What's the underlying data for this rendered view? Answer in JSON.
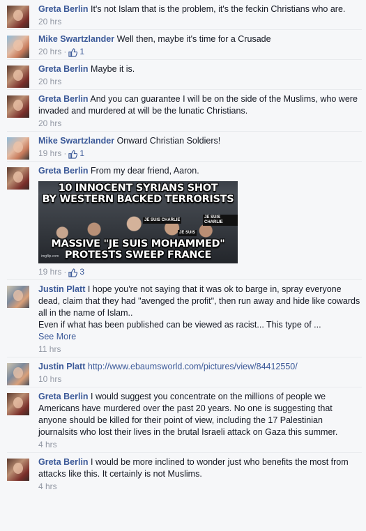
{
  "comments": [
    {
      "author": "Greta Berlin",
      "avatar": "greta",
      "text": "It's not Islam that is the problem, it's the feckin Christians who are.",
      "time": "20 hrs",
      "likes": ""
    },
    {
      "author": "Mike Swartzlander",
      "avatar": "mike",
      "text": "Well then, maybe it's time for a Crusade",
      "time": "20 hrs",
      "likes": "1"
    },
    {
      "author": "Greta Berlin",
      "avatar": "greta",
      "text": "Maybe it is.",
      "time": "20 hrs",
      "likes": ""
    },
    {
      "author": "Greta Berlin",
      "avatar": "greta",
      "text": "And you can guarantee I will be on the side of the Muslims, who were invaded and murdered at will be the lunatic Christians.",
      "time": "20 hrs",
      "likes": ""
    },
    {
      "author": "Mike Swartzlander",
      "avatar": "mike",
      "text": "Onward Christian Soldiers!",
      "time": "19 hrs",
      "likes": "1"
    },
    {
      "author": "Greta Berlin",
      "avatar": "greta",
      "text": "From my dear friend, Aaron.",
      "time": "19 hrs",
      "likes": "3",
      "image": {
        "headline_1": "10 INNOCENT SYRIANS SHOT",
        "headline_2": "BY WESTERN BACKED TERRORISTS",
        "headline_3": "MASSIVE \"JE SUIS MOHAMMED\"",
        "headline_4": "PROTESTS SWEEP FRANCE",
        "sign_a": "JE SUIS CHARLIE",
        "sign_b": "JE SUIS CHARLIE",
        "sign_c": "JE SUIS",
        "watermark": "imgflip.com"
      }
    },
    {
      "author": "Justin Platt",
      "avatar": "justin",
      "text": "I hope you're not saying that it was ok to barge in, spray everyone dead, claim that they had \"avenged the profit\", then run away and hide like cowards all in the name of Islam..",
      "text2": "Even if what has been published can be viewed as racist... This type of ...",
      "see_more": "See More",
      "time": "11 hrs",
      "likes": ""
    },
    {
      "author": "Justin Platt",
      "avatar": "justin",
      "text": "http://www.ebaumsworld.com/pictures/view/84412550/",
      "time": "10 hrs",
      "likes": ""
    },
    {
      "author": "Greta Berlin",
      "avatar": "greta",
      "text": "I would suggest you concentrate on the millions of people we Americans have murdered over the past 20 years. No one is suggesting that anyone should be killed for their point of view, including the 17 Palestinian journalsits who lost their lives in the brutal Israeli attack on Gaza this summer.",
      "time": "4 hrs",
      "likes": ""
    },
    {
      "author": "Greta Berlin",
      "avatar": "greta",
      "text": "I would be more inclined to wonder just who benefits the most from attacks like this. It certainly is not Muslims.",
      "time": "4 hrs",
      "likes": ""
    }
  ],
  "meta": {
    "dot": "·"
  },
  "colors": {
    "link": "#3b5998",
    "meta": "#9197a3",
    "background": "#f6f7f9"
  }
}
